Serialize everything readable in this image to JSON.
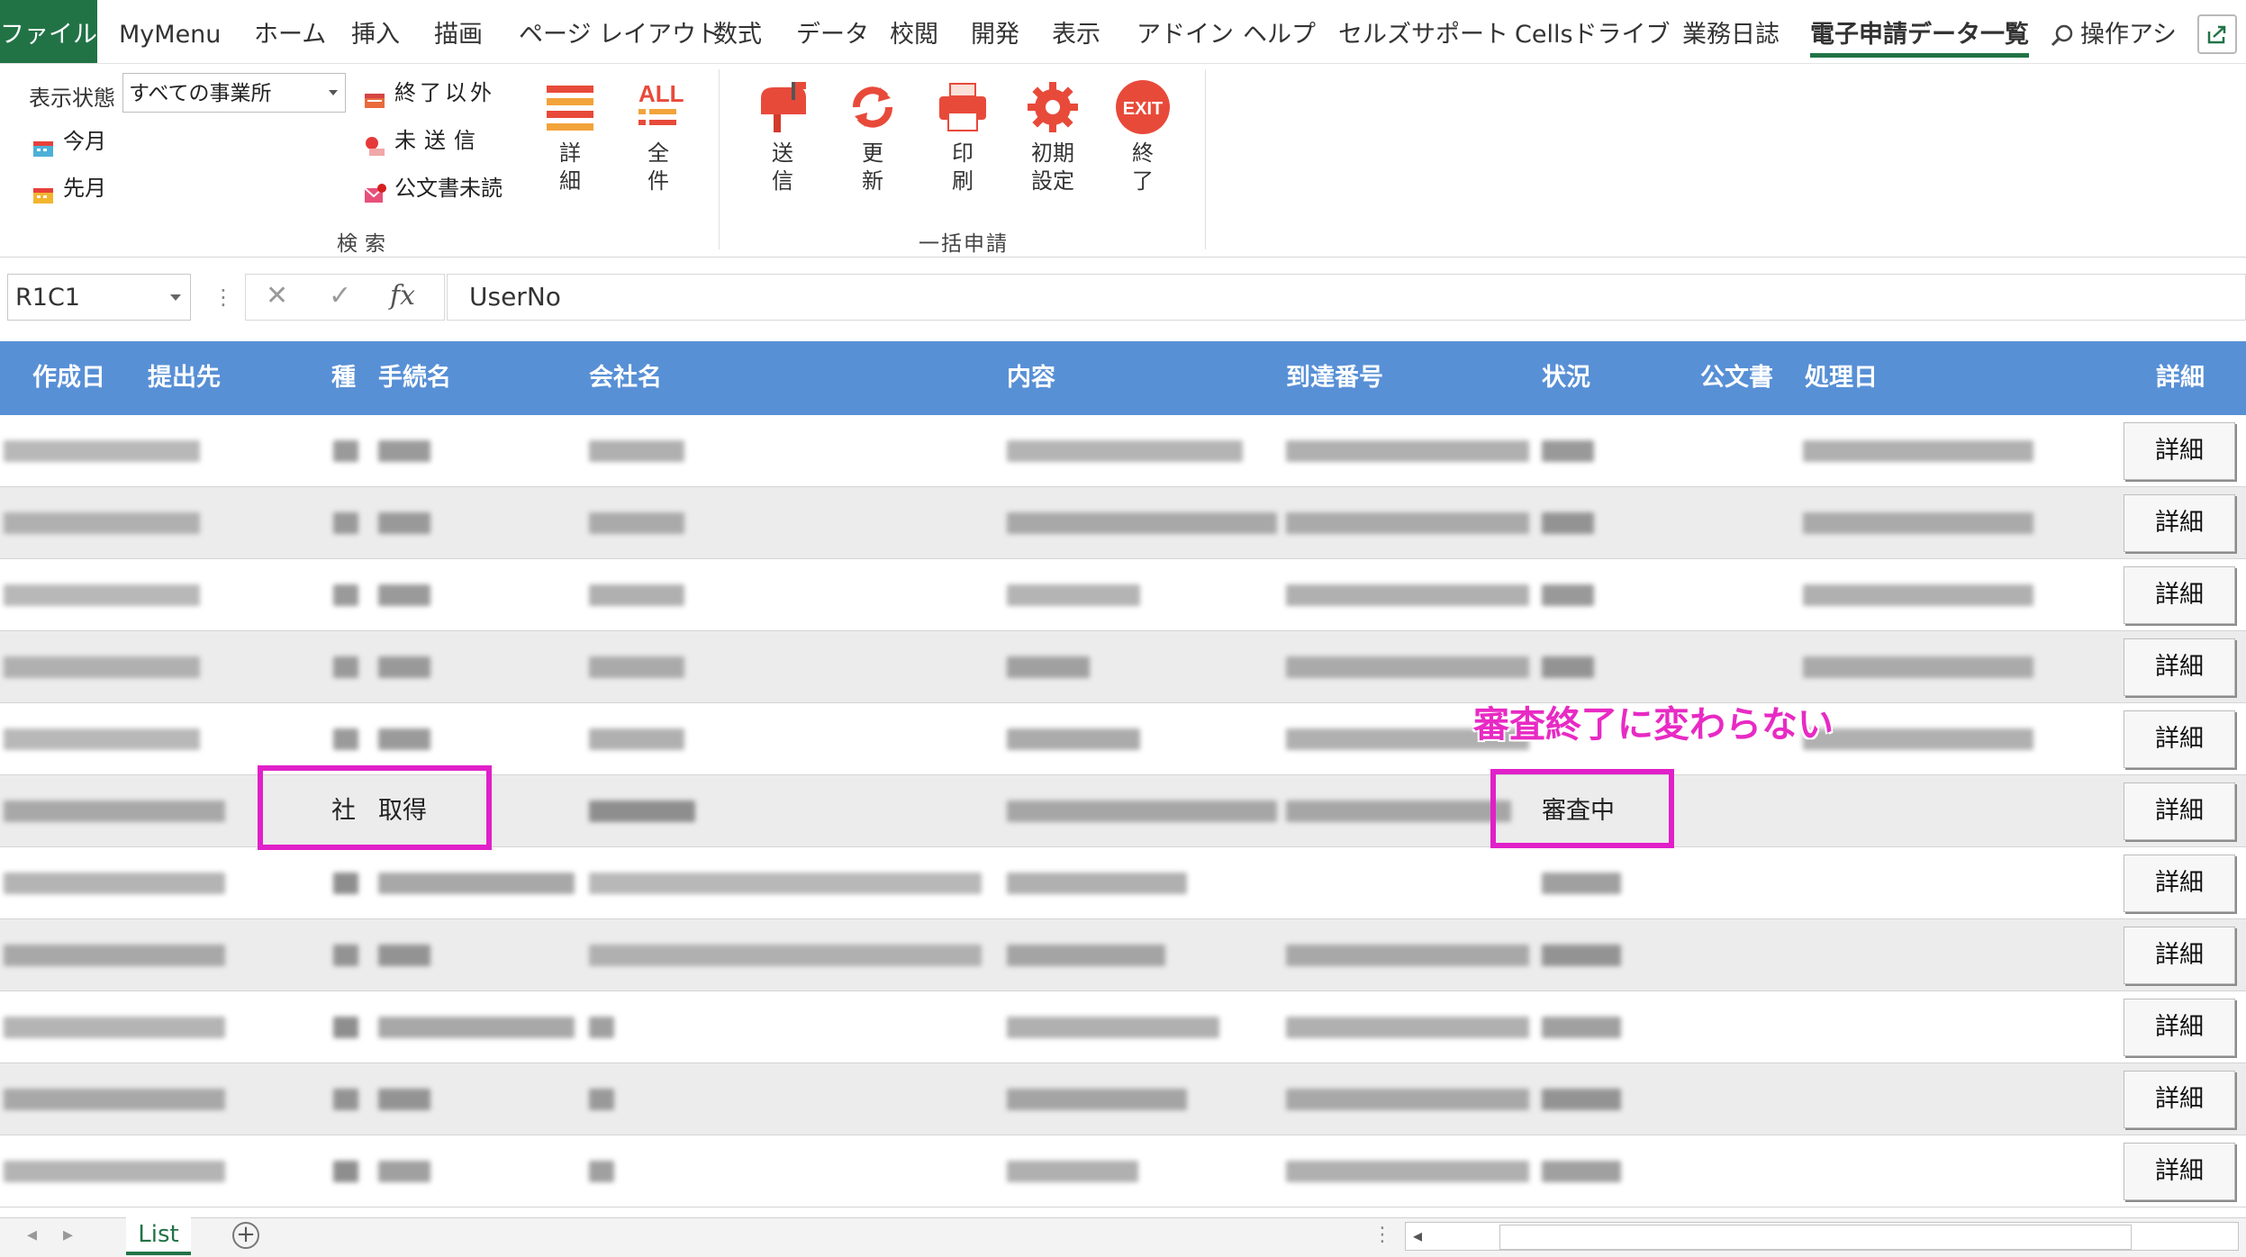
{
  "tabs": {
    "file": "ファイル",
    "mymenu": "MyMenu",
    "home": "ホーム",
    "insert": "挿入",
    "draw": "描画",
    "layout": "ページ レイアウト",
    "formulas": "数式",
    "data": "データ",
    "review": "校閲",
    "developer": "開発",
    "view": "表示",
    "addin": "アドイン",
    "help": "ヘルプ",
    "cells_support": "セルズサポート",
    "cells_drive": "Cellsドライブ",
    "diary": "業務日誌",
    "efiling_list": "電子申請データ一覧",
    "tell_me": "操作アシ"
  },
  "ribbon": {
    "display_state_label": "表示状態",
    "office_select": "すべての事業所",
    "this_month": "今月",
    "last_month": "先月",
    "not_finished": "終了以外",
    "not_sent": "未送信",
    "unread_docs": "公文書未読",
    "detail": "詳細",
    "all": "全件",
    "search_group": "検索",
    "send": "送信",
    "refresh": "更新",
    "print": "印刷",
    "init_settings": "初期設定",
    "exit": "終了",
    "batch_group": "一括申請",
    "all_icon_text": "ALL",
    "exit_icon_text": "EXIT"
  },
  "formula_bar": {
    "name_box": "R1C1",
    "cancel": "✕",
    "enter": "✓",
    "fx": "fx",
    "formula": "UserNo"
  },
  "table": {
    "columns": [
      "作成日",
      "提出先",
      "種",
      "手続名",
      "会社名",
      "内容",
      "到達番号",
      "状況",
      "公文書",
      "処理日",
      "詳細"
    ],
    "highlighted_row": {
      "type": "社",
      "procedure": "取得",
      "status": "審査中"
    },
    "detail_button": "詳細",
    "row_count": 11
  },
  "annotation": "審査終了に変わらない",
  "sheet": {
    "tab_name": "List",
    "add_symbol": "+"
  },
  "colors": {
    "excel_green": "#217346",
    "header_blue": "#5890d6",
    "highlight_magenta": "#e020c8",
    "annotation_pink": "#e82ac4"
  }
}
